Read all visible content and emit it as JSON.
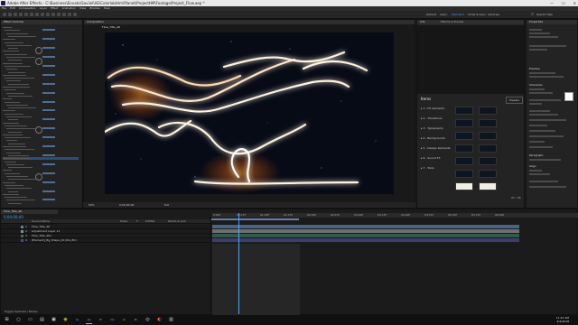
{
  "window": {
    "title": "Adobe After Effects - C:\\Business\\Envato\\Saviiel\\AE\\Colorlab\\Hm\\Planet\\ProjectHM\\Footage\\Project_Flow.aep *",
    "minimize": "—",
    "maximize": "☐",
    "close": "✕"
  },
  "menu": [
    "File",
    "Edit",
    "Composition",
    "Layer",
    "Effect",
    "Animation",
    "View",
    "Window",
    "Help"
  ],
  "workspaces": [
    "Default",
    "Learn",
    "Standard",
    "Small Screen",
    "Libraries"
  ],
  "active_workspace": "Standard",
  "search_help": "Search Help",
  "effect_controls": {
    "tab": "Effect Controls",
    "rows": 60
  },
  "composition": {
    "tab": "Composition",
    "subtab": "Flow_Title_46",
    "zoom": "50%",
    "quality": "Full",
    "timecode": "0;00;00;00"
  },
  "effects_browser": {
    "header": "Info",
    "tab2": "Effects & Presets",
    "title": "Items",
    "button": "Presets",
    "categories": [
      "1 - FX elements",
      "2 - Transitions",
      "3 - Typography",
      "4 - Backgrounds",
      "5 - Design elements",
      "6 - Sound FX",
      "7 - Tools"
    ],
    "count": "01 / 46"
  },
  "properties": {
    "header": "Properties",
    "preview": "Preview",
    "character": "Character",
    "paragraph": "Paragraph",
    "align": "Align"
  },
  "timeline": {
    "tab": "Flow_Title_46",
    "timecode": "0;00;00;00",
    "columns": [
      "Source Name",
      "Mode",
      "T",
      "TrkMat",
      "Parent & Link"
    ],
    "layers": [
      {
        "num": "1",
        "name": "Flow_Title_46",
        "color": "#5a7fa8"
      },
      {
        "num": "2",
        "name": "Adjustment Layer 11",
        "color": "#8c8c8c"
      },
      {
        "num": "3",
        "name": "Flow_Title_461",
        "color": "#3a6f5a"
      },
      {
        "num": "4",
        "name": "[Element]_Bg_Shape_20 (RG_BC)",
        "color": "#4a4a8c"
      }
    ],
    "ruler": [
      "0:00f",
      "00:15f",
      "01:00f",
      "01:15f",
      "02:00f",
      "02:15f",
      "03:00f",
      "03:15f",
      "04:00f",
      "04:15f",
      "05:00f",
      "05:15f",
      "06:00f"
    ],
    "toggle": "Toggle Switches / Modes"
  },
  "taskbar": {
    "time": "11:41 AM",
    "date": "4/4/2018",
    "apps": [
      "windows-icon",
      "search-icon",
      "task-view-icon",
      "folder-icon",
      "store-icon",
      "chrome-icon",
      "photoshop-icon",
      "after-effects-icon",
      "premiere-icon",
      "media-encoder-icon",
      "illustrator-icon",
      "bridge-icon",
      "cinema4d-icon",
      "firefox-icon",
      "explorer-icon"
    ]
  }
}
